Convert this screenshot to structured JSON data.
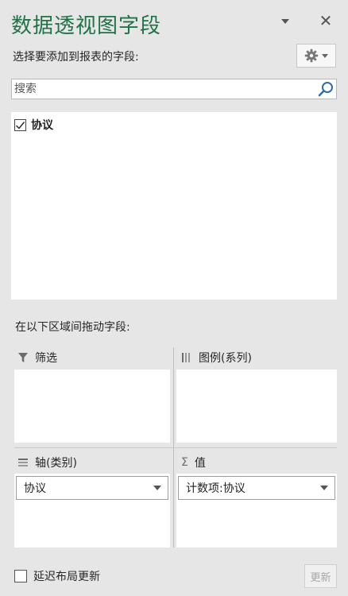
{
  "pane": {
    "title": "数据透视图字段",
    "instruction": "选择要添加到报表的字段:"
  },
  "search": {
    "placeholder": "搜索",
    "value": ""
  },
  "fields": [
    {
      "label": "协议",
      "checked": true
    }
  ],
  "areas": {
    "instruction": "在以下区域间拖动字段:",
    "filter": {
      "label": "筛选",
      "icon": "filter-icon"
    },
    "legend": {
      "label": "图例(系列)",
      "icon": "columns-icon"
    },
    "axis": {
      "label": "轴(类别)",
      "icon": "rows-icon",
      "items": [
        "协议"
      ]
    },
    "values": {
      "label": "值",
      "icon": "sigma-icon",
      "items": [
        "计数项:协议"
      ]
    }
  },
  "footer": {
    "defer_label": "延迟布局更新",
    "defer_checked": false,
    "update_label": "更新"
  },
  "colors": {
    "title": "#217346",
    "background": "#e6e6e6",
    "panel": "#ffffff"
  }
}
